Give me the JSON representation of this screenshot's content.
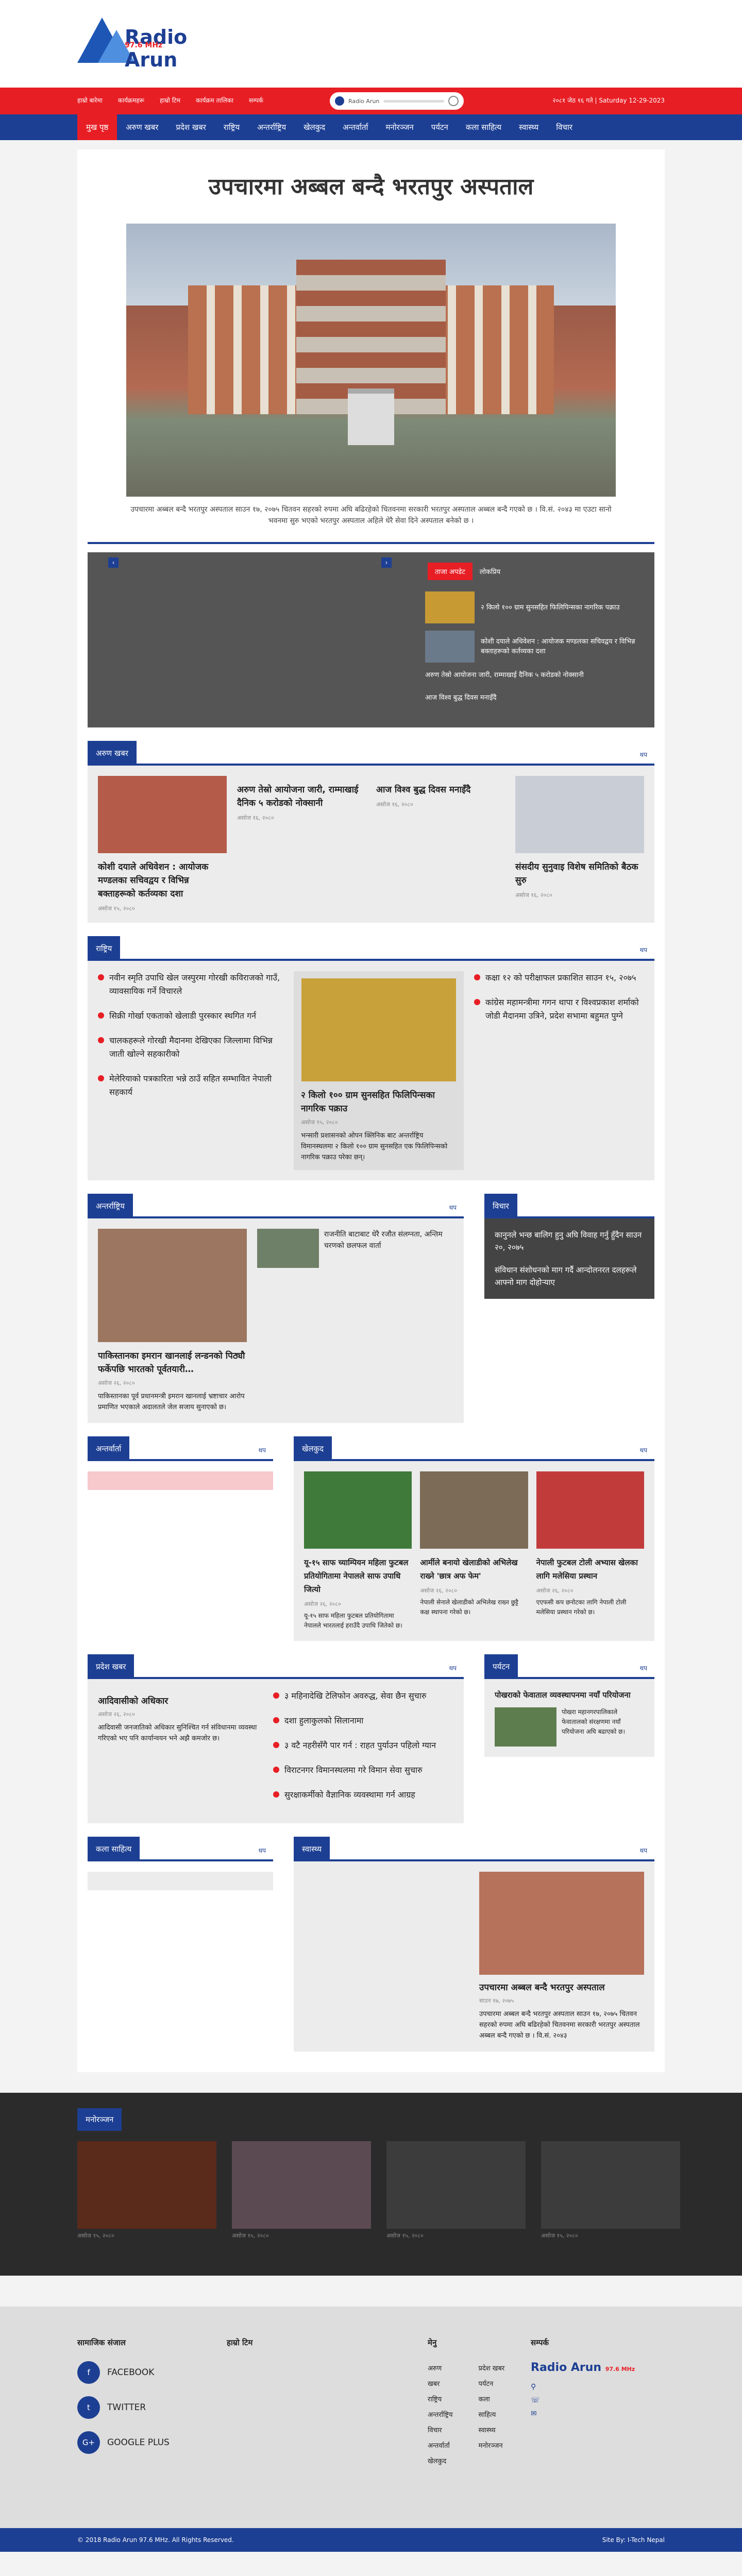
{
  "brand": {
    "name": "Radio Arun",
    "freq": "97.6 MHz"
  },
  "topbar": {
    "links": [
      "हाम्रो बारेमा",
      "कार्यक्रमहरू",
      "हाम्रो टिम",
      "कार्यक्रम तालिका",
      "सम्पर्क"
    ],
    "player_label": "Radio Arun",
    "date": "२०८१ जेठ १६ गते | Saturday 12-29-2023"
  },
  "nav": [
    "मुख पृष्ठ",
    "अरुण खबर",
    "प्रदेश खबर",
    "राष्ट्रिय",
    "अन्तर्राष्ट्रिय",
    "खेलकुद",
    "अन्तर्वार्ता",
    "मनोरञ्जन",
    "पर्यटन",
    "कला साहित्य",
    "स्वास्थ्य",
    "विचार"
  ],
  "article": {
    "title": "उपचारमा अब्बल बन्दै भरतपुर अस्पताल",
    "caption": "उपचारमा अब्बल बन्दै भरतपुर अस्पताल  साउन १७, २०७५ चितवन सहरको रुपमा अघि बढिरहेको चितवनमा सरकारी भरतपुर अस्पताल अब्बल बन्दै गएको छ । वि.सं. २०४३ मा एउटा सानो भवनमा सुरु भएको भरतपुर अस्पताल अहिले धेरै सेवा दिने अस्पताल बनेको छ ।"
  },
  "slider": {
    "tabs": [
      "ताजा अपडेट",
      "लोकप्रिय"
    ],
    "items": [
      "२ किलो १०० ग्राम सुनसहित फिलिपिन्सका नागरिक पक्राउ",
      "कोशी दयाले अधिवेशन : आयोजक मण्डलका सचिवद्वय र विभिन्न बक्ताहरूको कर्तव्यका दशा"
    ],
    "lines": [
      "अरुण तेस्रो आयोजना जारी, राम्माखाई दैनिक ५ करोडको नोक्सानी",
      "आज विश्व बुद्ध दिवस मनाइँदै"
    ]
  },
  "arun": {
    "label": "अरुण खबर",
    "more": "थप",
    "cards": [
      {
        "title": "कोशी दयाले अधिवेशन : आयोजक मण्डलका सचिवद्वय र विभिन्न बक्ताहरूको कर्तव्यका दशा",
        "date": "असोज १५, २०८०"
      },
      {
        "title": "अरुण तेस्रो आयोजना जारी, राम्माखाई दैनिक ५ करोडको नोक्सानी",
        "date": "असोज १६, २०८०"
      },
      {
        "title": "आज विश्व बुद्ध दिवस मनाइँदै",
        "date": "असोज १६, २०८०"
      },
      {
        "title": "संसदीय सुनुवाइ विशेष समितिको बैठक सुरु",
        "date": "असोज १६, २०८०"
      }
    ]
  },
  "national": {
    "label": "राष्ट्रिय",
    "more": "थप",
    "left": [
      "नवीन स्मृति उपाधि खेल जस्पुरमा गोरखी कविराजको गाउँ, व्यावसायिक गर्ने विचारले",
      "सिक्री गोर्खा एकताको खेलाडी पुरस्कार स्थगित गर्न",
      "चालकहरूले गोरखी मैदानमा देखिएका जिल्लामा विभिन्न जाती खोल्ने सहकारीको",
      "मेलेरियाको पत्रकारिता भन्ने ठाउँ सहित सम्भावित नेपाली सहकार्य"
    ],
    "center_title": "२ किलो १०० ग्राम सुनसहित फिलिपिन्सका नागरिक पक्राउ",
    "center_date": "असोज १५, २०८०",
    "center_text": "भन्सारी प्रशासनको ओपन क्लिनिक बाट अन्तर्राष्ट्रिय विमानस्थलमा २ किलो १०० ग्राम सुनसहित एक फिलिपिन्सको नागरिक पक्राउ परेका छन्।",
    "right": [
      "कक्षा १२ को परीक्षाफल प्रकाशित  साउन १५, २०७५",
      "कांग्रेस महामन्त्रीमा गगन थापा र विश्वप्रकाश शर्माको जोडी मैदानमा उत्रिने, प्रदेश सभामा बहुमत पुग्ने"
    ]
  },
  "international": {
    "label": "अन्तर्राष्ट्रिय",
    "more": "थप",
    "main_title": "पाकिस्तानका इमरान खानलाई लन्डनको पिठ्यौ फर्केपछि भारतको पूर्वतयारी…",
    "main_date": "असोज २६, २०८०",
    "main_text": "पाकिस्तानका पूर्व प्रधानमन्त्री इमरान खानलाई भ्रष्टाचार आरोप प्रमाणित भएकाले अदालतले जेल सजाय सुनाएको छ।",
    "side_title": "राजनीति बाटाबाट धेरै रजौत संलग्नता, अन्तिम चरणको छलफल वार्ता"
  },
  "opinion": {
    "label": "विचार",
    "items": [
      "कानुनले भन्छ बालिग हुनु अघि विवाह गर्नु हुँदैन  साउन २०, २०७५",
      "संविधान संशोधनको माग गर्दै आन्दोलनरत दलहरूले आफ्नो माग दोहोर्‍याए"
    ]
  },
  "interview": {
    "label": "अन्तर्वार्ता",
    "more": "थप"
  },
  "sports": {
    "label": "खेलकुद",
    "more": "थप",
    "cards": [
      {
        "title": "यू-१५ साफ च्याम्पियन महिला फुटबल प्रतियोगितामा नेपालले साफ उपाधि जित्यो",
        "date": "असोज २६, २०८०",
        "text": "यू-१५ साफ महिला फुटबल प्रतियोगितामा नेपालले भारतलाई हराउँदै उपाधि जितेको छ।"
      },
      {
        "title": "आर्मीले बनायो खेलाडीको अभिलेख राख्ने 'छात्र अफ फेम'",
        "date": "असोज २६, २०८०",
        "text": "नेपाली सेनाले खेलाडीको अभिलेख राख्न छुट्टै कक्ष स्थापना गरेको छ।"
      },
      {
        "title": "नेपाली फुटबल टोली अभ्यास खेलका लागि मलेसिया प्रस्थान",
        "date": "असोज २६, २०८०",
        "text": "एएफसी कप छनोटका लागि नेपाली टोली मलेसिया प्रस्थान गरेको छ।"
      }
    ]
  },
  "province": {
    "label": "प्रदेश खबर",
    "more": "थप",
    "main_title": "आदिवासीको अधिकार",
    "main_date": "असोज २६, २०८०",
    "main_text": "आदिवासी जनजातिको अधिकार सुनिश्चित गर्न संविधानमा व्यवस्था गरिएको भए पनि कार्यान्वयन भने अझै कमजोर छ।",
    "bullets": [
      "३ महिनादेखि टेलिफोन अवरुद्ध, सेवा छैन सुचारु",
      "दशा हुलाकुलको सिलानामा",
      "३ वटै नहरीसँगै पार गर्न : राहत पुर्याउन पहिलो ग्यान",
      "विराटनगर विमानस्थलमा गरे विमान सेवा सुचारु",
      "सुरक्षाकर्मीको वैज्ञानिक व्यवस्थामा गर्न आग्रह"
    ]
  },
  "tourism": {
    "label": "पर्यटन",
    "more": "थप",
    "title": "पोखराको फेवाताल व्यवस्थापनमा नयाँ परियोजना",
    "text": "पोखरा महानगरपालिकाले फेवातालको संरक्षणमा नयाँ परियोजना अघि बढाएको छ।"
  },
  "literature": {
    "label": "कला साहित्य",
    "more": "थप"
  },
  "health": {
    "label": "स्वास्थ्य",
    "more": "थप",
    "title": "उपचारमा अब्बल बन्दै भरतपुर अस्पताल",
    "date": "साउन १७, २०७५",
    "text": "उपचारमा अब्बल बन्दै भरतपुर अस्पताल  साउन १७, २०७५ चितवन सहरको रुपमा अघि बढिरहेको चितवनमा सरकारी भरतपुर अस्पताल अब्बल बन्दै गएको छ । वि.सं. २०४३"
  },
  "entertainment": {
    "label": "मनोरञ्जन",
    "cards": [
      {
        "date": "असोज १५, २०८०"
      },
      {
        "date": "असोज १५, २०८०"
      },
      {
        "date": "असोज १५, २०८०"
      },
      {
        "date": "असोज १५, २०८०"
      }
    ]
  },
  "footer": {
    "social_title": "सामाजिक संजाल",
    "social": [
      "FACEBOOK",
      "TWITTER",
      "GOOGLE PLUS"
    ],
    "team_title": "हाम्रो टिम",
    "menu_title": "मेनु",
    "menu_a": [
      "अरुण",
      "खबर",
      "राष्ट्रिय",
      "अन्तर्राष्ट्रिय",
      "विचार",
      "अन्तर्वार्ता",
      "खेलकुद"
    ],
    "menu_b": [
      "प्रदेश खबर",
      "पर्यटन",
      "कला",
      "साहित्य",
      "स्वास्थ्य",
      "मनोरञ्जन"
    ],
    "contact_title": "सम्पर्क",
    "copyright": "© 2018 Radio Arun 97.6 MHz. All Rights Reserved.",
    "credit": "Site By: I-Tech Nepal"
  }
}
